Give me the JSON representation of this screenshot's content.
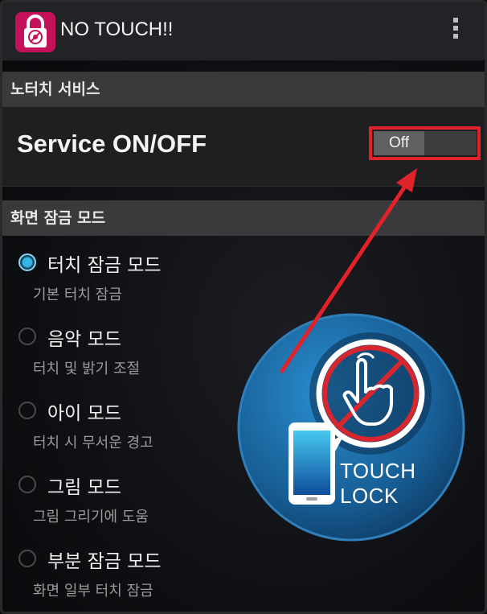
{
  "app": {
    "title": "NO TOUCH!!"
  },
  "sections": {
    "service": "노터치 서비스",
    "lock_mode": "화면 잠금 모드"
  },
  "service_row": {
    "label": "Service ON/OFF",
    "toggle_state": "Off"
  },
  "modes": [
    {
      "title": "터치 잠금 모드",
      "desc": "기본 터치 잠금",
      "selected": true
    },
    {
      "title": "음악 모드",
      "desc": "터치 및 밝기 조절",
      "selected": false
    },
    {
      "title": "아이 모드",
      "desc": "터치 시 무서운 경고",
      "selected": false
    },
    {
      "title": "그림 모드",
      "desc": "그림 그리기에 도움",
      "selected": false
    },
    {
      "title": "부분 잠금 모드",
      "desc": "화면 일부 터치 잠금",
      "selected": false
    }
  ],
  "badge": {
    "line1": "TOUCH",
    "line2": "LOCK"
  },
  "colors": {
    "accent": "#33b5e5",
    "highlight": "#e0232a",
    "app_icon": "#c4125a",
    "badge": "#1b6fa8"
  }
}
